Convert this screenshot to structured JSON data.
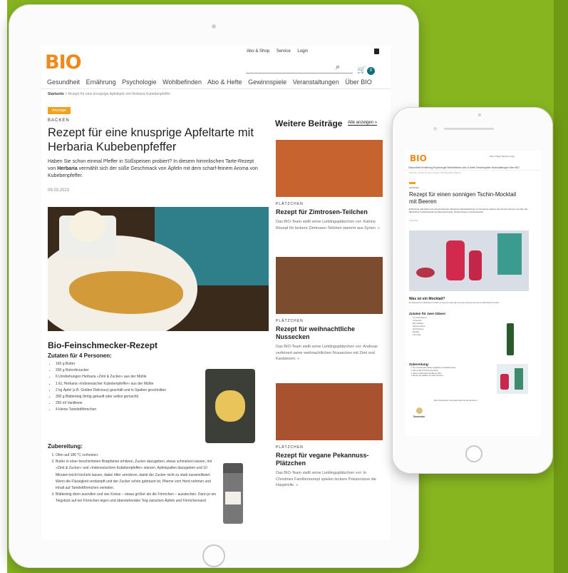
{
  "tablet": {
    "logo": "BIO",
    "top_links": [
      "Abo & Shop",
      "Service",
      "Login"
    ],
    "cart_count": "0",
    "nav": [
      "Gesundheit",
      "Ernährung",
      "Psychologie",
      "Wohlbefinden",
      "Abo & Hefte",
      "Gewinnspiele",
      "Veranstaltungen",
      "Über BIO"
    ],
    "breadcrumb": {
      "home": "Startseite",
      "current": "Rezept für eine knusprige Apfeltarte mit Herbaria Kubebenpfeffer"
    },
    "article": {
      "badge": "Anzeige",
      "category": "BACKEN",
      "title": "Rezept für eine knusprige Apfeltarte mit Herbaria Kubebenpfeffer",
      "lead_1": "Haben Sie schon einmal Pfeffer in Süßspeisen probiert? In diesem himmlischen Tarte-Rezept von ",
      "lead_brand": "Herbaria",
      "lead_2": " vermählt sich der süße Geschmack von Äpfeln mit dem scharf-feinem Aroma von Kubebenpfeffer.",
      "date": "09.03.2023",
      "section_title": "Bio-Feinschmecker-Rezept",
      "ingredients_title": "Zutaten für 4 Personen:",
      "ingredients": [
        "160 g Butter",
        "200 g Rohrohrzucker",
        "6 Umdrehungen Herbaria »Zimt & Zucker« aus der Mühle",
        "1 EL Herbaria »Indonesischer Kubebenpfeffer« aus der Mühle",
        "2 kg Äpfel (z.B. Golden Delicious) geschält und in Spalten geschnitten",
        "300 g Blätterteig (fertig gekauft oder selbst gemacht)",
        "250 ml Vanilleeis",
        "4 kleine Tartelettförmchen"
      ],
      "steps_title": "Zubereitung:",
      "steps": [
        "Ofen auf 180 °C vorheizen.",
        "Butter in einer beschichteten Bratpfanne erhitzen, Zucker dazugeben, etwas schmelzen lassen, mit »Zimt & Zucker« und »Indonesischem Kubebenpfeffer« würzen. Apfelspalten dazugeben und 10 Minuten leicht köcheln lassen, dabei öfter umrühren, damit der Zucker nicht zu stark karamellisiert. Wenn die Flüssigkeit verdampft und der Zucker schön gebräunt ist, Pfanne vom Herd nehmen und Inhalt auf Tartelettförmchen verteilen.",
        "Blätterteig dünn ausrollen und vier Kreise – etwas größer als die Förmchen – ausstechen. Dann je ein Teigstück auf ein Förmchen legen und überstehenden Teig zwischen Äpfeln und Förmchenrand"
      ]
    },
    "sidebar": {
      "title": "Weitere Beiträge",
      "show_all": "Alle anzeigen »",
      "cards": [
        {
          "kicker": "PLÄTZCHEN",
          "title": "Rezept für Zimtrosen-Teilchen",
          "desc": "Das BIO-Team stellt seine Lieblingsplätzchen vor: Katrins Rezept für leckere Zimtrosen-Teilchen stammt aus Syrien. »"
        },
        {
          "kicker": "PLÄTZCHEN",
          "title": "Rezept für weihnachtliche Nussecken",
          "desc": "Das BIO-Team stellt seine Lieblingsplätzchen vor: Andreas verfeinert seine weihnachtlichen Nussecken mit Zimt und Kardamom. »"
        },
        {
          "kicker": "PLÄTZCHEN",
          "title": "Rezept für vegane Pekannuss-Plätzchen",
          "desc": "Das BIO-Team stellt seine Lieblingsplätzchen vor: In Christines Familienrezept spielen leckere Pekannüsse die Hauptrolle. »"
        }
      ]
    }
  },
  "phone": {
    "logo": "BIO",
    "top_links": "Abo & Shop   Service   Login",
    "nav": "Gesundheit  Ernährung  Psychologie  Wohlbefinden  Abo & Hefte  Gewinnspiele  Veranstaltungen  Über BIO",
    "breadcrumb": "Startseite > Rezept für einen sonnigen Tschin-Mocktail mit Beeren",
    "category": "GETRÄNKE",
    "title": "Rezept für einen sonnigen Tschin-Mocktail mit Beeren",
    "lead": "Erfrischend, alkoholfrei und schnell zubereitet: Mit diesem Mocktail-Rezept von Sonnentor zaubern Sie sich den Sommer ins Glas. Der alkoholfreie Cocktail besteht aus Beerenlimonade, frischen Beeren und Zitronensaft.",
    "date": "01.08.2023",
    "section_title": "Was ist ein Mocktail?",
    "section_text": "Ein Mocktail ist ein alkoholfreier Cocktail, der genauso aufwendig und kreativ zubereitet wird wie sein alkoholisches Pendant.",
    "ingredients_title": "Zutaten für zwei Gläser:",
    "ingredients": [
      "2 TL Tschin Beeren",
      "1 Prise Zimt",
      "500 ml Wasser",
      "Saft einer Zitrone",
      "Frische Beeren",
      "Eiswürfel",
      "2 EL Honig"
    ],
    "steps_title": "Zubereitung:",
    "steps": [
      "Tee mit kochendem Wasser aufgießen und abkühlen lassen.",
      "Zitronensaft und Honig unterrühren.",
      "Gläser mit Eiswürfeln und Beeren füllen.",
      "Mit dem Tee auffüllen und sofort servieren."
    ],
    "note": "Mehr Informationen zu Rezepten finden Sie bei Sonnentor »",
    "brand": "Sonnentor"
  }
}
